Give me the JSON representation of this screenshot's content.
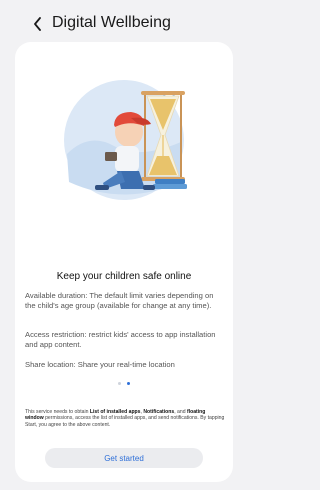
{
  "header": {
    "title": "Digital Wellbeing",
    "back_icon": "chevron-left-icon"
  },
  "content": {
    "headline": "Keep your children safe online",
    "paragraphs": [
      "Available duration: The default limit varies depending on the child's age group (available for change at any time).",
      "Access restriction: restrict kids' access to app installation and app content.",
      "Share location: Share your real-time location"
    ],
    "page_indicator": {
      "count": 2,
      "active_index": 1
    },
    "notice": {
      "prefix": "This service needs to obtain ",
      "bold1": "List of installed apps",
      "sep1": ", ",
      "bold2": "Notifications",
      "sep2": ", and ",
      "bold3": "floating window",
      "suffix": " permissions, access the list of installed apps, and send notifications. By tapping Start, you agree to the above content."
    },
    "button_label": "Get started"
  },
  "colors": {
    "accent": "#2e6fd8",
    "background": "#f2f2f4",
    "card": "#ffffff"
  }
}
